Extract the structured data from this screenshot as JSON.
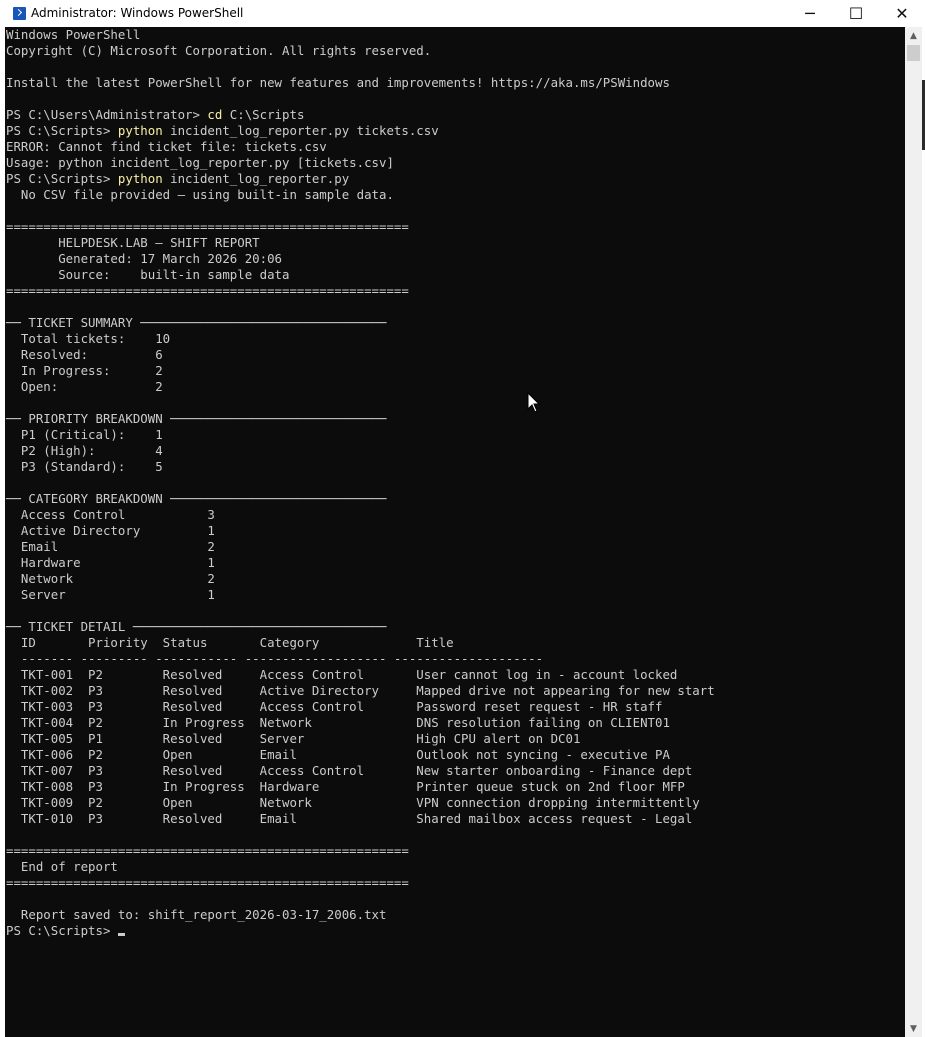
{
  "window": {
    "title": "Administrator: Windows PowerShell",
    "minimize_glyph": "─",
    "maximize_glyph": "☐",
    "close_glyph": "✕",
    "app_icon": "powershell-icon"
  },
  "scrollbar": {
    "up_glyph": "▲",
    "down_glyph": "▼"
  },
  "console": {
    "lines": [
      {
        "t": "Windows PowerShell"
      },
      {
        "t": "Copyright (C) Microsoft Corporation. All rights reserved."
      },
      {
        "t": ""
      },
      {
        "t": "Install the latest PowerShell for new features and improvements! https://aka.ms/PSWindows"
      },
      {
        "t": ""
      },
      {
        "t": "PS C:\\Users\\Administrator> ",
        "cmd": "cd",
        "rest": " C:\\Scripts"
      },
      {
        "t": "PS C:\\Scripts> ",
        "cmd": "python",
        "rest": " incident_log_reporter.py tickets.csv"
      },
      {
        "t": "ERROR: Cannot find ticket file: tickets.csv"
      },
      {
        "t": "Usage: python incident_log_reporter.py [tickets.csv]"
      },
      {
        "t": "PS C:\\Scripts> ",
        "cmd": "python",
        "rest": " incident_log_reporter.py"
      },
      {
        "t": "  No CSV file provided — using built-in sample data."
      },
      {
        "t": ""
      },
      {
        "t": "======================================================"
      },
      {
        "t": "       HELPDESK.LAB — SHIFT REPORT"
      },
      {
        "t": "       Generated: 17 March 2026 20:06"
      },
      {
        "t": "       Source:    built-in sample data"
      },
      {
        "t": "======================================================"
      },
      {
        "t": ""
      },
      {
        "t": "── TICKET SUMMARY ─────────────────────────────────"
      },
      {
        "t": "  Total tickets:    10"
      },
      {
        "t": "  Resolved:         6"
      },
      {
        "t": "  In Progress:      2"
      },
      {
        "t": "  Open:             2"
      },
      {
        "t": ""
      },
      {
        "t": "── PRIORITY BREAKDOWN ─────────────────────────────"
      },
      {
        "t": "  P1 (Critical):    1"
      },
      {
        "t": "  P2 (High):        4"
      },
      {
        "t": "  P3 (Standard):    5"
      },
      {
        "t": ""
      },
      {
        "t": "── CATEGORY BREAKDOWN ─────────────────────────────"
      },
      {
        "t": "  Access Control           3"
      },
      {
        "t": "  Active Directory         1"
      },
      {
        "t": "  Email                    2"
      },
      {
        "t": "  Hardware                 1"
      },
      {
        "t": "  Network                  2"
      },
      {
        "t": "  Server                   1"
      },
      {
        "t": ""
      },
      {
        "t": "── TICKET DETAIL ──────────────────────────────────"
      },
      {
        "t": "  ID       Priority  Status       Category             Title"
      },
      {
        "t": "  ------- --------- ----------- ------------------- --------------------"
      },
      {
        "t": "  TKT-001  P2        Resolved     Access Control       User cannot log in - account locked"
      },
      {
        "t": "  TKT-002  P3        Resolved     Active Directory     Mapped drive not appearing for new start"
      },
      {
        "t": "  TKT-003  P3        Resolved     Access Control       Password reset request - HR staff"
      },
      {
        "t": "  TKT-004  P2        In Progress  Network              DNS resolution failing on CLIENT01"
      },
      {
        "t": "  TKT-005  P1        Resolved     Server               High CPU alert on DC01"
      },
      {
        "t": "  TKT-006  P2        Open         Email                Outlook not syncing - executive PA"
      },
      {
        "t": "  TKT-007  P3        Resolved     Access Control       New starter onboarding - Finance dept"
      },
      {
        "t": "  TKT-008  P3        In Progress  Hardware             Printer queue stuck on 2nd floor MFP"
      },
      {
        "t": "  TKT-009  P2        Open         Network              VPN connection dropping intermittently"
      },
      {
        "t": "  TKT-010  P3        Resolved     Email                Shared mailbox access request - Legal"
      },
      {
        "t": ""
      },
      {
        "t": "======================================================"
      },
      {
        "t": "  End of report"
      },
      {
        "t": "======================================================"
      },
      {
        "t": ""
      },
      {
        "t": "  Report saved to: shift_report_2026-03-17_2006.txt"
      },
      {
        "t": "PS C:\\Scripts> ",
        "cursor": true
      }
    ]
  },
  "colors": {
    "console_bg": "#0c0c0c",
    "console_fg": "#cccccc",
    "command_fg": "#f9f1a5"
  }
}
